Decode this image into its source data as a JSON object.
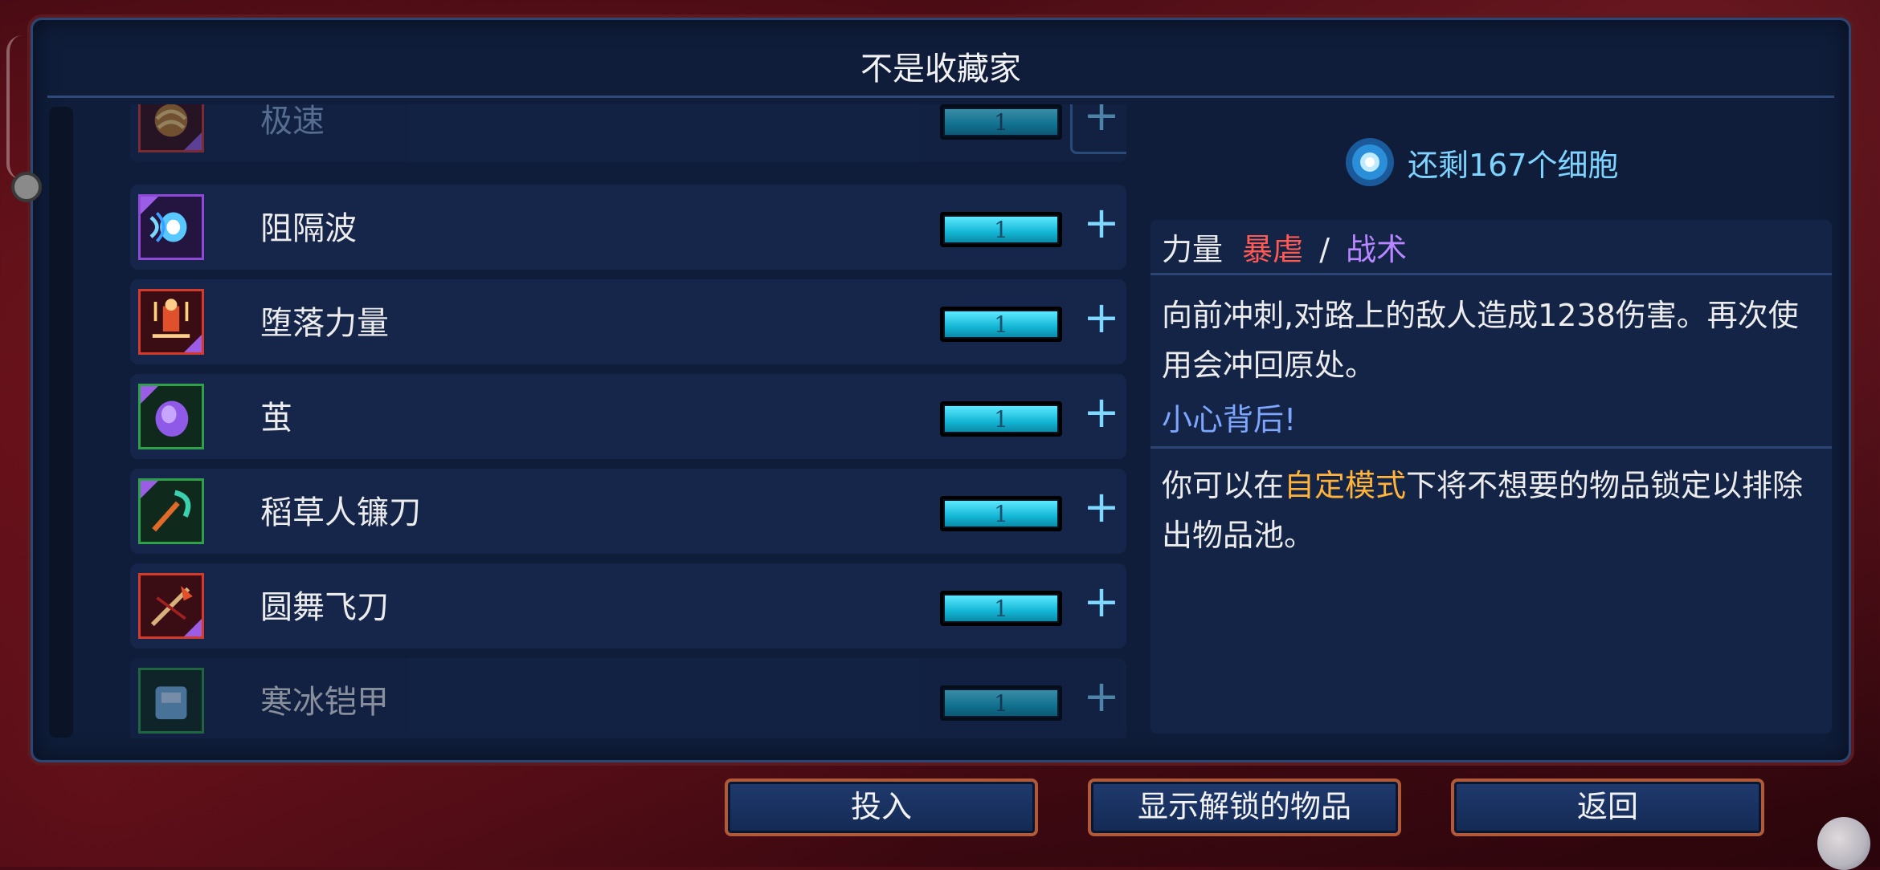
{
  "title": "不是收藏家",
  "cells": {
    "text": "还剩167个细胞"
  },
  "items": [
    {
      "name": "极速",
      "qty": "1",
      "border": "red",
      "dim": true
    },
    {
      "name": "阻隔波",
      "qty": "1",
      "border": "purple",
      "dim": false
    },
    {
      "name": "堕落力量",
      "qty": "1",
      "border": "red",
      "dim": false
    },
    {
      "name": "茧",
      "qty": "1",
      "border": "green",
      "dim": false
    },
    {
      "name": "稻草人镰刀",
      "qty": "1",
      "border": "green",
      "dim": false
    },
    {
      "name": "圆舞飞刀",
      "qty": "1",
      "border": "red",
      "dim": false
    },
    {
      "name": "寒冰铠甲",
      "qty": "1",
      "border": "green",
      "dim": true
    }
  ],
  "plus_label": "+",
  "detail": {
    "tag_power": "力量",
    "tag_brutality": "暴虐",
    "tag_separator": "/",
    "tag_tactics": "战术",
    "description": "向前冲刺,对路上的敌人造成1238伤害。再次使用会冲回原处。",
    "flavor": "小心背后!",
    "hint_before": "你可以在",
    "hint_highlight": "自定模式",
    "hint_after": "下将不想要的物品锁定以排除出物品池。"
  },
  "buttons": {
    "invest": "投入",
    "show_unlocked": "显示解锁的物品",
    "back": "返回"
  },
  "colors": {
    "brutality": "#ff5a52",
    "tactics": "#b887ff",
    "highlight": "#ffb33a",
    "cells": "#7fd3ff"
  }
}
